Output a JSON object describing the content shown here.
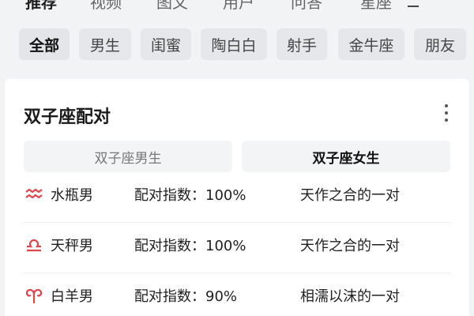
{
  "top_nav": {
    "tabs": [
      "推荐",
      "视频",
      "图文",
      "用户",
      "问答",
      "星座"
    ],
    "active_index": 0
  },
  "filters": {
    "chips": [
      "全部",
      "男生",
      "闺蜜",
      "陶白白",
      "射手",
      "金牛座",
      "朋友"
    ],
    "active_index": 0
  },
  "card": {
    "title": "双子座配对",
    "more_icon": "more-vertical-icon",
    "segments": [
      "双子座男生",
      "双子座女生"
    ],
    "active_segment": 1,
    "rows": [
      {
        "icon": "aquarius-icon",
        "name": "水瓶男",
        "score": "配对指数：100%",
        "desc": "天作之合的一对"
      },
      {
        "icon": "libra-icon",
        "name": "天秤男",
        "score": "配对指数：100%",
        "desc": "天作之合的一对"
      },
      {
        "icon": "aries-icon",
        "name": "白羊男",
        "score": "配对指数：90%",
        "desc": "相濡以沫的一对"
      }
    ]
  },
  "colors": {
    "page_bg": "#f2f3f5",
    "card_bg": "#ffffff",
    "chip_bg": "#e6e7ea",
    "zodiac_icon": "#e0454b"
  }
}
